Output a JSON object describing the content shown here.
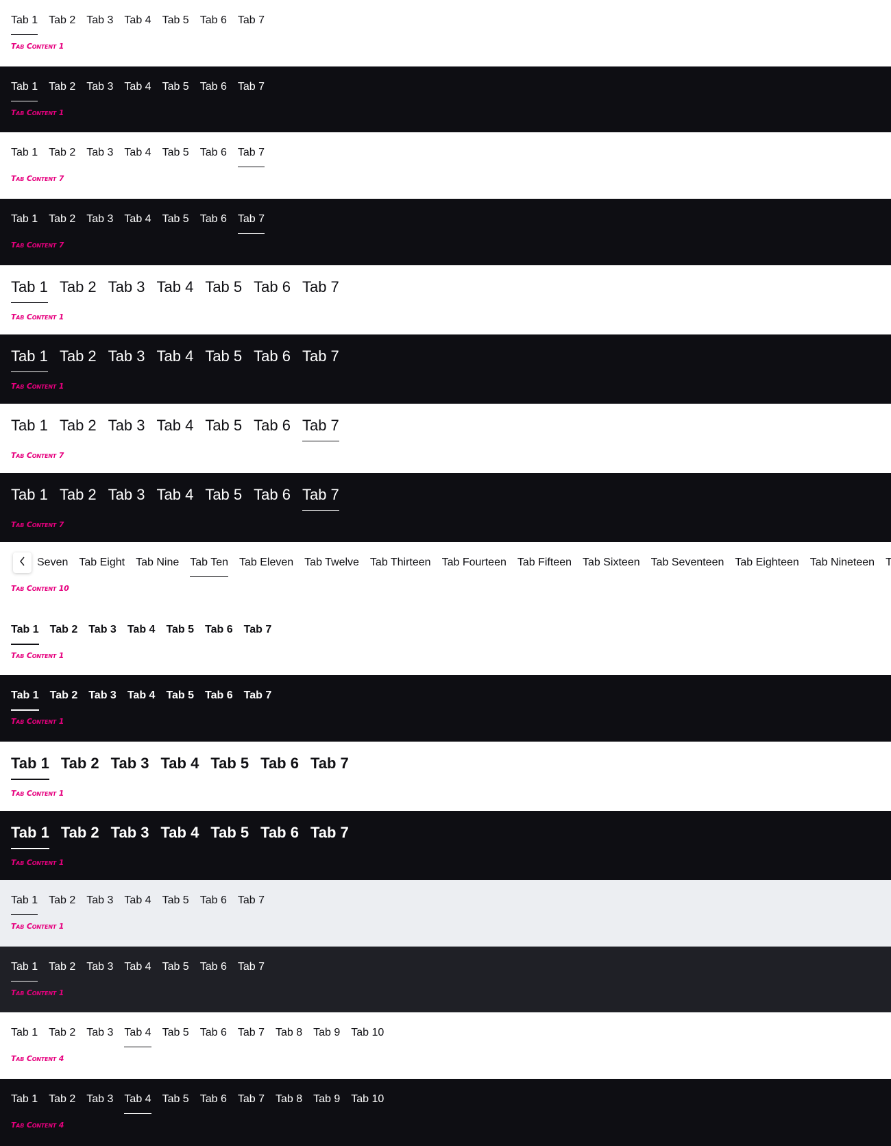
{
  "colors": {
    "content_text": "#e6007e",
    "light_bg": "#ffffff",
    "dark_bg": "#0e0e13",
    "gray_light_bg": "#eceef2",
    "gray_dark_bg": "#1f2026",
    "light_text": "#101014",
    "dark_text": "#ffffff"
  },
  "sections": [
    {
      "theme": "light",
      "size": "sm",
      "weight": "regular",
      "active": 0,
      "tabs": [
        "Tab 1",
        "Tab 2",
        "Tab 3",
        "Tab 4",
        "Tab 5",
        "Tab 6",
        "Tab 7"
      ],
      "content": "Tab Content 1"
    },
    {
      "theme": "dark",
      "size": "sm",
      "weight": "regular",
      "active": 0,
      "tabs": [
        "Tab 1",
        "Tab 2",
        "Tab 3",
        "Tab 4",
        "Tab 5",
        "Tab 6",
        "Tab 7"
      ],
      "content": "Tab Content 1"
    },
    {
      "theme": "light",
      "size": "sm",
      "weight": "regular",
      "active": 6,
      "tabs": [
        "Tab 1",
        "Tab 2",
        "Tab 3",
        "Tab 4",
        "Tab 5",
        "Tab 6",
        "Tab 7"
      ],
      "content": "Tab Content 7"
    },
    {
      "theme": "dark",
      "size": "sm",
      "weight": "regular",
      "active": 6,
      "tabs": [
        "Tab 1",
        "Tab 2",
        "Tab 3",
        "Tab 4",
        "Tab 5",
        "Tab 6",
        "Tab 7"
      ],
      "content": "Tab Content 7"
    },
    {
      "theme": "light",
      "size": "lg",
      "weight": "regular",
      "active": 0,
      "tabs": [
        "Tab 1",
        "Tab 2",
        "Tab 3",
        "Tab 4",
        "Tab 5",
        "Tab 6",
        "Tab 7"
      ],
      "content": "Tab Content 1"
    },
    {
      "theme": "dark",
      "size": "lg",
      "weight": "regular",
      "active": 0,
      "tabs": [
        "Tab 1",
        "Tab 2",
        "Tab 3",
        "Tab 4",
        "Tab 5",
        "Tab 6",
        "Tab 7"
      ],
      "content": "Tab Content 1"
    },
    {
      "theme": "light",
      "size": "lg",
      "weight": "regular",
      "active": 6,
      "tabs": [
        "Tab 1",
        "Tab 2",
        "Tab 3",
        "Tab 4",
        "Tab 5",
        "Tab 6",
        "Tab 7"
      ],
      "content": "Tab Content 7"
    },
    {
      "theme": "dark",
      "size": "lg",
      "weight": "regular",
      "active": 6,
      "tabs": [
        "Tab 1",
        "Tab 2",
        "Tab 3",
        "Tab 4",
        "Tab 5",
        "Tab 6",
        "Tab 7"
      ],
      "content": "Tab Content 7"
    },
    {
      "theme": "light",
      "size": "sm",
      "weight": "regular",
      "active": 3,
      "scrollable": true,
      "scroll_icon": "chevron-left-icon",
      "tabs": [
        "Seven",
        "Tab Eight",
        "Tab Nine",
        "Tab Ten",
        "Tab Eleven",
        "Tab Twelve",
        "Tab Thirteen",
        "Tab Fourteen",
        "Tab Fifteen",
        "Tab Sixteen",
        "Tab Seventeen",
        "Tab Eighteen",
        "Tab Nineteen",
        "Tab Twenty"
      ],
      "content": "Tab Content 10"
    },
    {
      "theme": "light",
      "size": "sm",
      "weight": "semibold",
      "active": 0,
      "tabs": [
        "Tab 1",
        "Tab 2",
        "Tab 3",
        "Tab 4",
        "Tab 5",
        "Tab 6",
        "Tab 7"
      ],
      "content": "Tab Content 1"
    },
    {
      "theme": "dark",
      "size": "sm",
      "weight": "semibold",
      "active": 0,
      "tabs": [
        "Tab 1",
        "Tab 2",
        "Tab 3",
        "Tab 4",
        "Tab 5",
        "Tab 6",
        "Tab 7"
      ],
      "content": "Tab Content 1"
    },
    {
      "theme": "light",
      "size": "lg",
      "weight": "bold",
      "active": 0,
      "tabs": [
        "Tab 1",
        "Tab 2",
        "Tab 3",
        "Tab 4",
        "Tab 5",
        "Tab 6",
        "Tab 7"
      ],
      "content": "Tab Content 1"
    },
    {
      "theme": "dark",
      "size": "lg",
      "weight": "bold",
      "active": 0,
      "tabs": [
        "Tab 1",
        "Tab 2",
        "Tab 3",
        "Tab 4",
        "Tab 5",
        "Tab 6",
        "Tab 7"
      ],
      "content": "Tab Content 1"
    },
    {
      "theme": "gray-light",
      "size": "sm",
      "weight": "regular",
      "active": 0,
      "tabs": [
        "Tab 1",
        "Tab 2",
        "Tab 3",
        "Tab 4",
        "Tab 5",
        "Tab 6",
        "Tab 7"
      ],
      "content": "Tab Content 1"
    },
    {
      "theme": "gray-dark",
      "size": "sm",
      "weight": "regular",
      "active": 0,
      "tabs": [
        "Tab 1",
        "Tab 2",
        "Tab 3",
        "Tab 4",
        "Tab 5",
        "Tab 6",
        "Tab 7"
      ],
      "content": "Tab Content 1"
    },
    {
      "theme": "light",
      "size": "sm",
      "weight": "regular",
      "active": 3,
      "tabs": [
        "Tab 1",
        "Tab 2",
        "Tab 3",
        "Tab 4",
        "Tab 5",
        "Tab 6",
        "Tab 7",
        "Tab 8",
        "Tab 9",
        "Tab 10"
      ],
      "content": "Tab Content 4"
    },
    {
      "theme": "dark",
      "size": "sm",
      "weight": "regular",
      "active": 3,
      "tabs": [
        "Tab 1",
        "Tab 2",
        "Tab 3",
        "Tab 4",
        "Tab 5",
        "Tab 6",
        "Tab 7",
        "Tab 8",
        "Tab 9",
        "Tab 10"
      ],
      "content": "Tab Content 4"
    }
  ]
}
